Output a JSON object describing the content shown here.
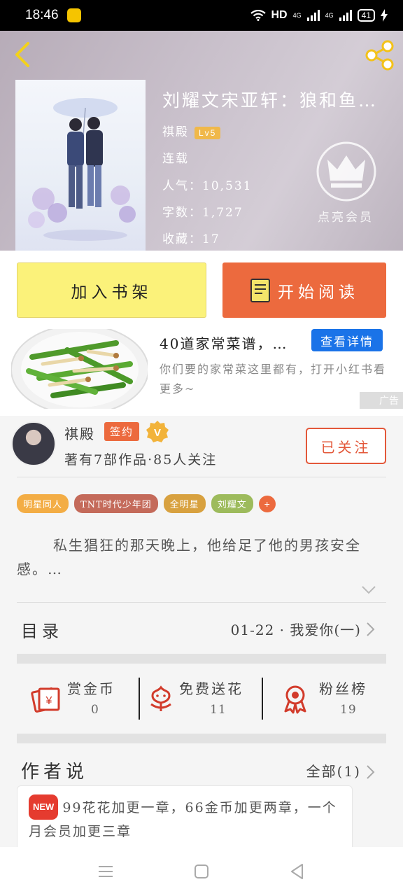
{
  "status_bar": {
    "time": "18:46",
    "network": "HD",
    "signal_1": "4G",
    "signal_2": "4G",
    "battery": "41"
  },
  "book": {
    "title": "刘耀文宋亚轩：狼和鱼…",
    "author": "祺殿",
    "level": "Lv5",
    "status": "连载",
    "popularity": "人气：10,531",
    "word_count": "字数：1,727",
    "favorites": "收藏：17"
  },
  "vip": {
    "label": "点亮会员"
  },
  "actions": {
    "add_shelf": "加入书架",
    "start_read": "开始阅读"
  },
  "ad": {
    "title": "40道家常菜谱，…",
    "cta": "查看详情",
    "description": "你们要的家常菜这里都有，打开小红书看更多~",
    "tag": "广告"
  },
  "author_card": {
    "name": "祺殿",
    "signed_label": "签约",
    "vip_badge": "V",
    "stats": "著有7部作品·85人关注",
    "follow_label": "已关注"
  },
  "tags": [
    {
      "label": "明星同人",
      "color": "#f3ad45"
    },
    {
      "label": "TNT时代少年团",
      "color": "#c46a5a"
    },
    {
      "label": "全明星",
      "color": "#d8a13f"
    },
    {
      "label": "刘耀文",
      "color": "#9dbb5c"
    }
  ],
  "tag_more": "+",
  "synopsis": "私生猖狂的那天晚上，他给足了他的男孩安全感。…",
  "catalog": {
    "label": "目录",
    "latest": "01-22 · 我爱你(一)"
  },
  "gifts": [
    {
      "label": "赏金币",
      "count": "0",
      "icon": "coin-envelope-icon"
    },
    {
      "label": "免费送花",
      "count": "11",
      "icon": "flower-icon"
    },
    {
      "label": "粉丝榜",
      "count": "19",
      "icon": "medal-icon"
    }
  ],
  "author_says": {
    "label": "作者说",
    "all": "全部(1)",
    "badge": "NEW",
    "content": "99花花加更一章，66金币加更两章，一个月会员加更三章"
  },
  "colors": {
    "accent": "#ec6a3e",
    "shelf_yellow": "#fbf27a",
    "cta_blue": "#1a73e8",
    "new_red": "#e53b2f"
  }
}
